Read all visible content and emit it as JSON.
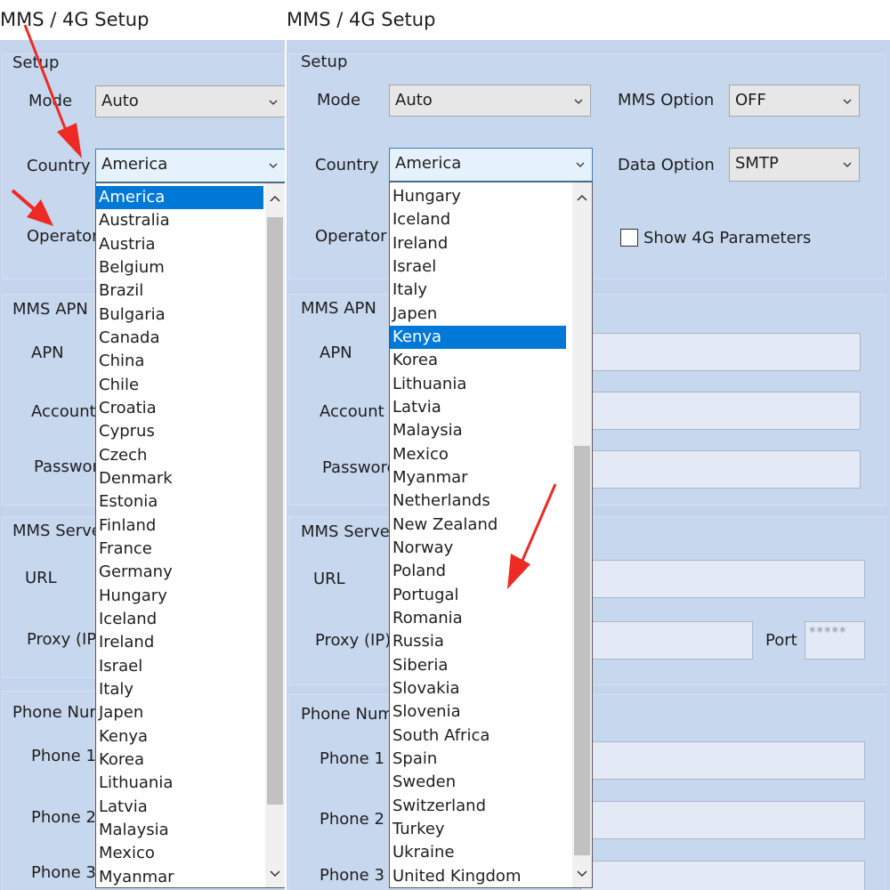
{
  "left": {
    "window_title": "MMS / 4G Setup",
    "setup_group": "Setup",
    "mode_label": "Mode",
    "mode_value": "Auto",
    "country_label": "Country",
    "country_value": "America",
    "operator_label": "Operator",
    "mms_apn_group": "MMS APN",
    "apn_label": "APN",
    "account_label": "Account",
    "password_label": "Password",
    "mms_server_group": "MMS Server",
    "url_label": "URL",
    "proxy_label": "Proxy (IP)",
    "phone_group": "Phone Numbe",
    "phone1_label": "Phone 1",
    "phone2_label": "Phone 2",
    "phone3_label": "Phone 3",
    "country_list": [
      "America",
      "Australia",
      "Austria",
      "Belgium",
      "Brazil",
      "Bulgaria",
      "Canada",
      "China",
      "Chile",
      "Croatia",
      "Cyprus",
      "Czech",
      "Denmark",
      "Estonia",
      "Finland",
      "France",
      "Germany",
      "Hungary",
      "Iceland",
      "Ireland",
      "Israel",
      "Italy",
      "Japen",
      "Kenya",
      "Korea",
      "Lithuania",
      "Latvia",
      "Malaysia",
      "Mexico",
      "Myanmar"
    ],
    "selected_country": "America"
  },
  "right": {
    "window_title": "MMS / 4G Setup",
    "setup_group": "Setup",
    "mode_label": "Mode",
    "mode_value": "Auto",
    "country_label": "Country",
    "country_value": "America",
    "operator_label": "Operator",
    "mms_option_label": "MMS Option",
    "mms_option_value": "OFF",
    "data_option_label": "Data Option",
    "data_option_value": "SMTP",
    "show_4g_label": "Show 4G Parameters",
    "mms_apn_group": "MMS APN",
    "apn_label": "APN",
    "account_label": "Account",
    "password_label": "Password",
    "mms_server_group": "MMS Server",
    "url_label": "URL",
    "proxy_label": "Proxy (IP)",
    "port_label": "Port",
    "port_value": "*****",
    "phone_group": "Phone Numbe",
    "phone1_label": "Phone 1",
    "phone2_label": "Phone 2",
    "phone3_label": "Phone 3",
    "country_list": [
      "Hungary",
      "Iceland",
      "Ireland",
      "Israel",
      "Italy",
      "Japen",
      "Kenya",
      "Korea",
      "Lithuania",
      "Latvia",
      "Malaysia",
      "Mexico",
      "Myanmar",
      "Netherlands",
      "New Zealand",
      "Norway",
      "Poland",
      "Portugal",
      "Romania",
      "Russia",
      "Siberia",
      "Slovakia",
      "Slovenia",
      "South Africa",
      "Spain",
      "Sweden",
      "Switzerland",
      "Turkey",
      "Ukraine",
      "United Kingdom"
    ],
    "selected_country": "Kenya"
  },
  "colors": {
    "window_bg": "#c3d4ec",
    "selection": "#0078d7",
    "annotation_arrow": "#ee2a24"
  }
}
